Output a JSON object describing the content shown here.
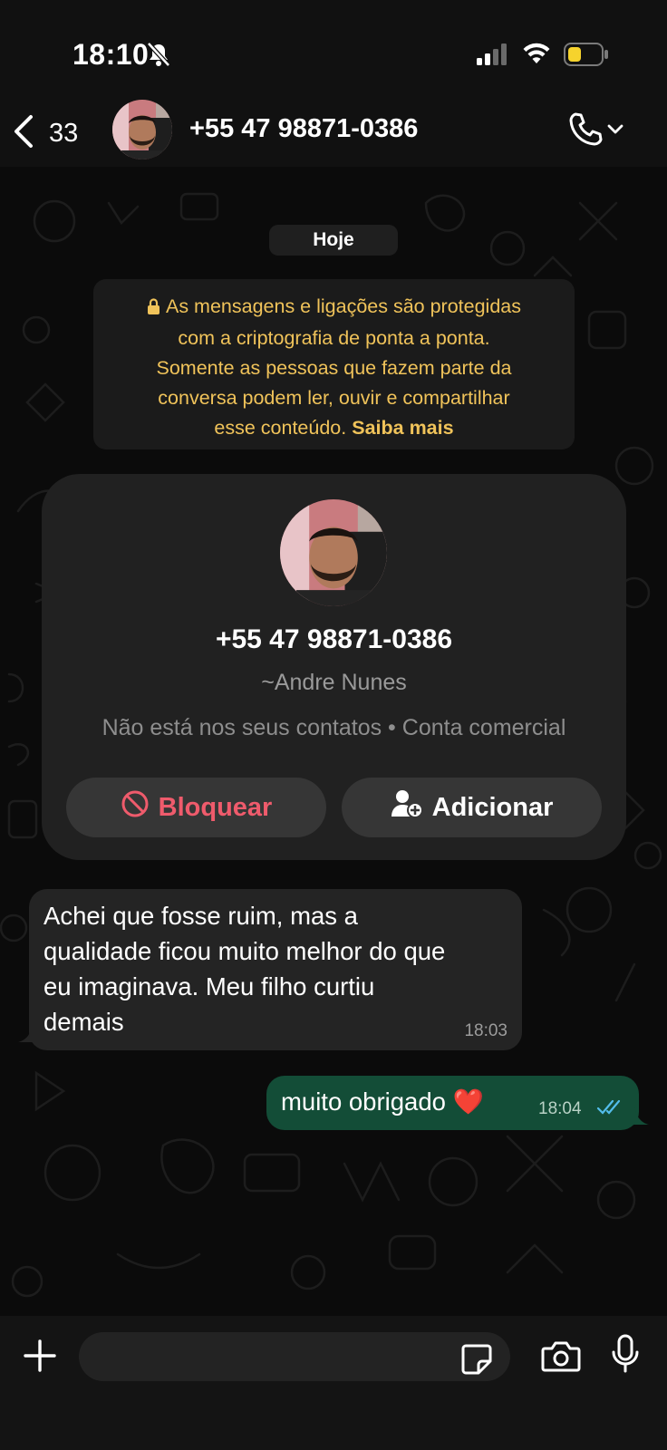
{
  "status_bar": {
    "time": "18:10"
  },
  "header": {
    "back_count": "33",
    "title": "+55 47 98871-0386"
  },
  "chat": {
    "date_chip": "Hoje",
    "e2e_notice": {
      "line1": "As mensagens e ligações são protegidas",
      "line2": "com a criptografia de ponta a ponta.",
      "line3": "Somente as pessoas que fazem parte da",
      "line4": "conversa podem ler, ouvir e compartilhar",
      "line5": "esse conteúdo.",
      "learn_more": "Saiba mais"
    },
    "contact_card": {
      "phone": "+55 47 98871-0386",
      "alias": "~Andre Nunes",
      "info": "Não está nos seus contatos • Conta comercial",
      "block_label": "Bloquear",
      "add_label": "Adicionar"
    },
    "messages": [
      {
        "direction": "incoming",
        "lines": [
          "Achei que fosse ruim, mas a",
          "qualidade ficou muito melhor do que",
          "eu imaginava. Meu filho curtiu",
          "demais"
        ],
        "time": "18:03"
      },
      {
        "direction": "outgoing",
        "text": "muito obrigado ❤️",
        "time": "18:04",
        "status": "read"
      }
    ]
  },
  "colors": {
    "background": "#0b0b0b",
    "outgoing_bubble": "#134d37",
    "incoming_bubble": "#242424",
    "notice_text": "#f0c35a",
    "block_red": "#ef5b6c",
    "read_ticks": "#53bdeb"
  },
  "icons": [
    "bell-off-icon",
    "signal-icon",
    "wifi-icon",
    "battery-icon",
    "chevron-left-icon",
    "phone-icon",
    "chevron-down-icon",
    "lock-icon",
    "block-icon",
    "add-user-icon",
    "double-check-icon",
    "plus-icon",
    "sticker-icon",
    "camera-icon",
    "mic-icon"
  ]
}
